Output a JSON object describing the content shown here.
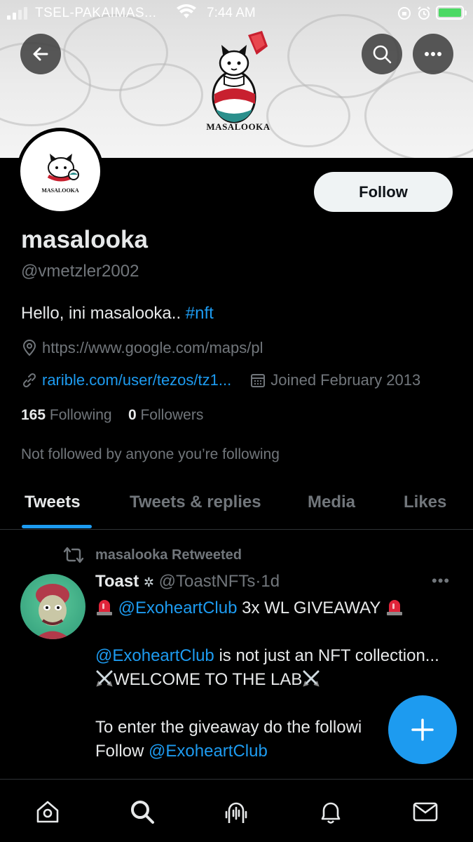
{
  "status_bar": {
    "carrier": "TSEL-PAKAIMAS...",
    "time": "7:44 AM",
    "battery_color": "#4cd964"
  },
  "banner": {
    "logo_text": "MASALOOKA",
    "back_icon": "arrow-left-icon",
    "search_icon": "search-icon",
    "more_icon": "more-horizontal-icon"
  },
  "profile": {
    "avatar_text": "MASALOOKA",
    "follow_label": "Follow",
    "name": "masalooka",
    "handle": "@vmetzler2002",
    "bio_text": "Hello, ini masalooka.. ",
    "bio_hashtag": "#nft",
    "location": "https://www.google.com/maps/pl",
    "website": "rarible.com/user/tezos/tz1...",
    "joined": "Joined February 2013",
    "following_count": "165",
    "following_label": "Following",
    "followers_count": "0",
    "followers_label": "Followers",
    "not_followed": "Not followed by anyone you’re following"
  },
  "tabs": [
    {
      "label": "Tweets",
      "active": true
    },
    {
      "label": "Tweets & replies",
      "active": false
    },
    {
      "label": "Media",
      "active": false
    },
    {
      "label": "Likes",
      "active": false
    }
  ],
  "tweet": {
    "retweet_line": "masalooka Retweeted",
    "author_name": "Toast",
    "author_handle": "@ToastNFTs",
    "separator": "·",
    "age": "1d",
    "more": "•••",
    "line1_mention": "@ExoheartClub",
    "line1_text": " 3x WL GIVEAWAY ",
    "line2_mention": "@ExoheartClub",
    "line2_text": " is not just an NFT collection...",
    "line3_text": "WELCOME TO THE LAB",
    "line4_text": "To enter the giveaway do the followi",
    "line5_text": "Follow ",
    "line5_mention": "@ExoheartClub"
  },
  "colors": {
    "accent": "#1d9bf0",
    "background": "#000000",
    "muted": "#71767b",
    "text": "#e7e9ea"
  },
  "bottom_nav": [
    "home-icon",
    "search-icon",
    "spaces-icon",
    "notifications-icon",
    "messages-icon"
  ]
}
